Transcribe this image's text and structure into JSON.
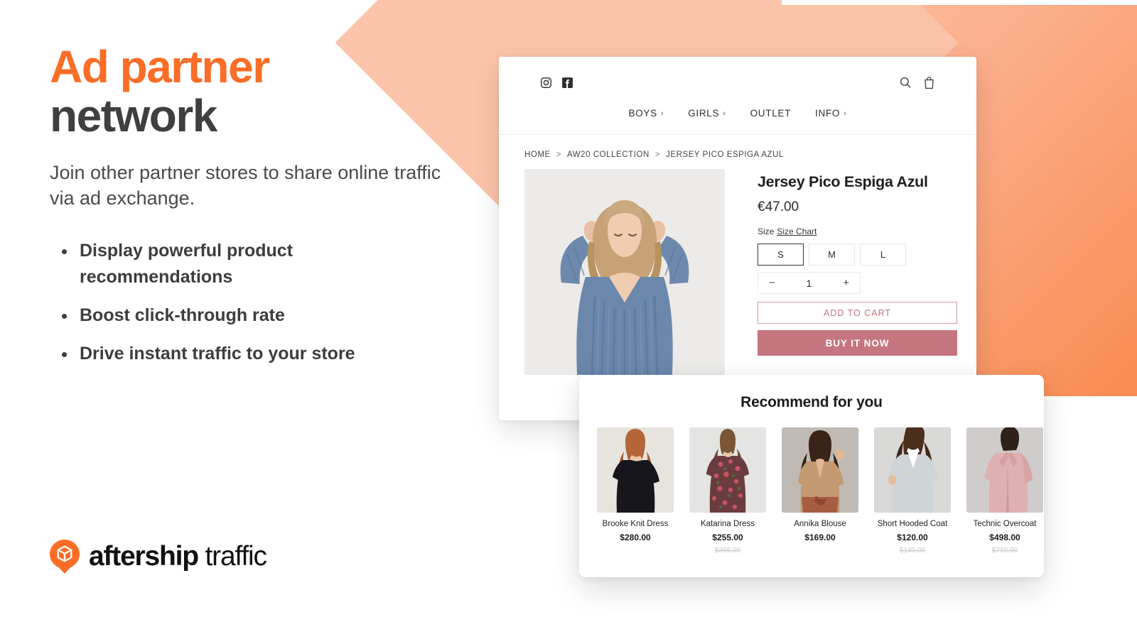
{
  "hero": {
    "headline_accent": "Ad partner",
    "headline_rest": "network",
    "subhead": "Join other partner stores to share online traffic via ad exchange.",
    "bullets": [
      "Display powerful product recommendations",
      "Boost click-through rate",
      "Drive instant traffic to your store"
    ]
  },
  "logo": {
    "brand": "aftership",
    "product": "traffic"
  },
  "store": {
    "social": [
      {
        "name": "instagram-icon"
      },
      {
        "name": "facebook-icon"
      }
    ],
    "actions": [
      {
        "name": "search-icon"
      },
      {
        "name": "shopping-bag-icon"
      }
    ],
    "nav": [
      {
        "label": "BOYS",
        "chevron": "›"
      },
      {
        "label": "GIRLS",
        "chevron": "›"
      },
      {
        "label": "OUTLET",
        "chevron": ""
      },
      {
        "label": "INFO",
        "chevron": "›"
      }
    ],
    "breadcrumb": {
      "items": [
        "HOME",
        "AW20 COLLECTION",
        "JERSEY PICO ESPIGA AZUL"
      ],
      "separator": ">"
    },
    "product": {
      "title": "Jersey Pico Espiga Azul",
      "price": "€47.00",
      "size_label": "Size",
      "size_chart_link": "Size Chart",
      "sizes": [
        {
          "label": "S",
          "selected": true
        },
        {
          "label": "M",
          "selected": false
        },
        {
          "label": "L",
          "selected": false
        }
      ],
      "quantity": {
        "decrement": "−",
        "value": "1",
        "increment": "+"
      },
      "add_to_cart_label": "ADD TO CART",
      "buy_now_label": "BUY IT NOW"
    }
  },
  "recommendations": {
    "title": "Recommend for you",
    "items": [
      {
        "name": "Brooke Knit Dress",
        "price": "$280.00",
        "compare_at": ""
      },
      {
        "name": "Katarina Dress",
        "price": "$255.00",
        "compare_at": "$366.00"
      },
      {
        "name": "Annika Blouse",
        "price": "$169.00",
        "compare_at": ""
      },
      {
        "name": "Short Hooded Coat",
        "price": "$120.00",
        "compare_at": "$140.00"
      },
      {
        "name": "Technic Overcoat",
        "price": "$498.00",
        "compare_at": "$710.00"
      }
    ]
  },
  "colors": {
    "brand_orange": "#fc6d26",
    "peach": "#fbc4aa",
    "orange_block": "#f98b50",
    "buy_now": "#c4757d",
    "add_to_cart_text": "#c07680",
    "heading_dark": "#3d3d3d"
  }
}
